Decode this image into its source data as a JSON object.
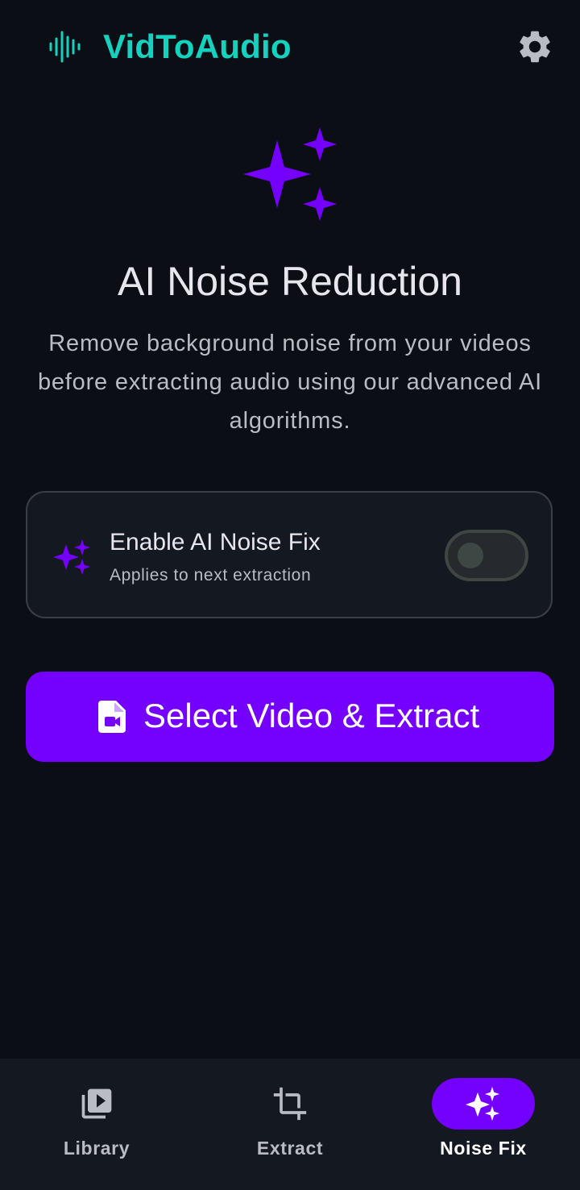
{
  "app": {
    "title": "VidToAudio",
    "logo_icon": "waveform-icon",
    "settings_icon": "gear-icon",
    "accent_color": "#15d1bd",
    "primary_color": "#7400fe"
  },
  "hero": {
    "icon": "sparkles-icon",
    "title": "AI Noise Reduction",
    "description": "Remove background noise from your videos before extracting audio using our advanced AI algorithms."
  },
  "noise_fix_card": {
    "icon": "sparkles-icon",
    "title": "Enable AI Noise Fix",
    "subtitle": "Applies to next extraction",
    "enabled": false
  },
  "main_action": {
    "icon": "video-file-icon",
    "label": "Select Video & Extract"
  },
  "bottom_nav": {
    "items": [
      {
        "label": "Library",
        "icon": "video-library-icon",
        "active": false
      },
      {
        "label": "Extract",
        "icon": "crop-icon",
        "active": false
      },
      {
        "label": "Noise Fix",
        "icon": "sparkles-icon",
        "active": true
      }
    ]
  }
}
